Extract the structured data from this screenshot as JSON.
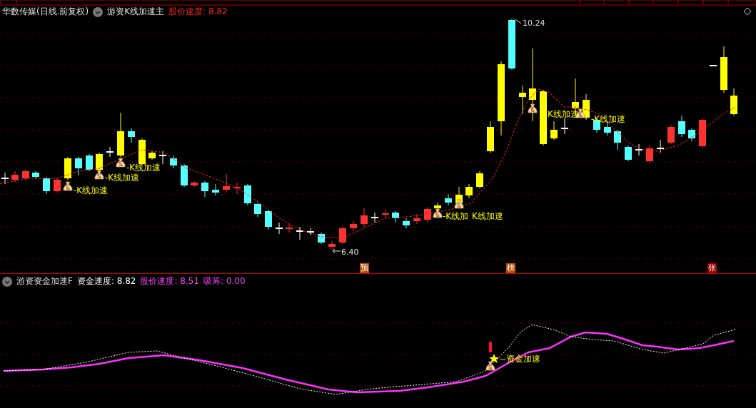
{
  "top_pane": {
    "title": "华数传媒(日线.前复权)",
    "indicator": "游资K线加速主",
    "readouts": [
      {
        "text": "股价速度: 8.82",
        "color": "#ff2020"
      }
    ],
    "price_labels": [
      "10.24",
      "6.40"
    ],
    "signals": [
      "-K线加速",
      "-K线加速",
      "-K线加速",
      "-K线加",
      "K线加速",
      "K线加速",
      "-K线加速"
    ],
    "event_markers": [
      {
        "text": "预",
        "color": "#b84a00"
      },
      {
        "text": "榜",
        "color": "#b84a00"
      },
      {
        "text": "张",
        "color": "#9a0000"
      }
    ]
  },
  "bottom_pane": {
    "indicator": "游资资金加速F",
    "readouts": [
      {
        "text": "资金速度: 8.82",
        "color": "#ffffff"
      },
      {
        "text": "股价速度: 8.51",
        "color": "#ff40ff"
      },
      {
        "text": "吸筹: 0.00",
        "color": "#ff40ff"
      }
    ],
    "signal": "--资金加速"
  }
}
